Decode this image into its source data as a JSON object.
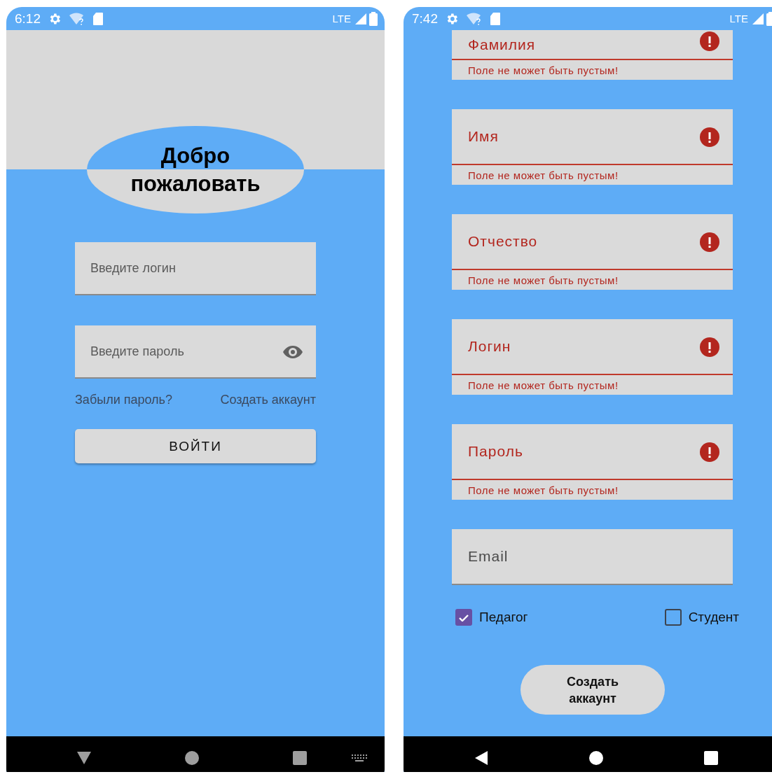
{
  "phones": [
    {
      "status_bar": {
        "time": "6:12",
        "network": "LTE"
      },
      "login_screen": {
        "title": "Добро пожаловать",
        "fields": [
          {
            "kind": "text",
            "placeholder": "Введите логин"
          },
          {
            "kind": "password",
            "placeholder": "Введите пароль"
          }
        ],
        "links": [
          "Забыли пароль?",
          "Создать аккаунт"
        ],
        "button": "ВОЙТИ"
      },
      "nav_bar": {
        "keyboard_shown": true
      }
    },
    {
      "status_bar": {
        "time": "7:42",
        "network": "LTE"
      },
      "register_screen": {
        "fields": [
          {
            "placeholder": "Фамилия",
            "error": "Поле не может быть пустым!",
            "cut": true
          },
          {
            "placeholder": "Имя",
            "error": "Поле не может быть пустым!",
            "cut": false
          },
          {
            "placeholder": "Отчество",
            "error": "Поле не может быть пустым!",
            "cut": false
          },
          {
            "placeholder": "Логин",
            "error": "Поле не может быть пустым!",
            "cut": false
          },
          {
            "placeholder": "Пароль",
            "error": "Поле не может быть пустым!",
            "cut": false
          },
          {
            "placeholder": "Email",
            "cut": false
          }
        ],
        "checkboxes": [
          {
            "label": "Педагог",
            "checked": true
          },
          {
            "label": "Студент",
            "checked": false
          }
        ],
        "button": "Создать аккаунт"
      },
      "nav_bar": {
        "keyboard_shown": false
      }
    }
  ]
}
